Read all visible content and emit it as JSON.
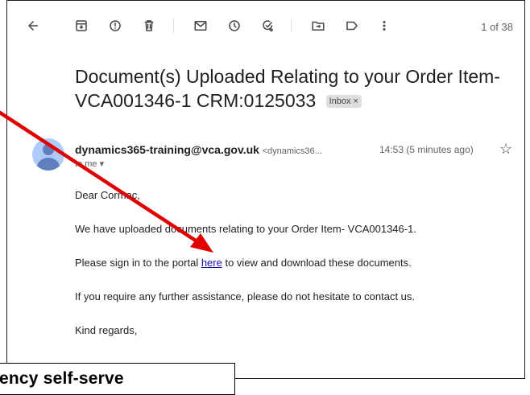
{
  "toolbar": {
    "back_icon": "arrow-left-icon",
    "counter": "1 of 38"
  },
  "message": {
    "subject": "Document(s) Uploaded Relating to your Order Item- VCA001346-1 CRM:0125033",
    "label_chip": "Inbox",
    "label_chip_close": "×",
    "sender_name": "dynamics365-training@vca.gov.uk",
    "sender_email": "<dynamics36...",
    "time": "14:53 (5 minutes ago)",
    "recipient": "to me",
    "greeting": "Dear Cormac,",
    "para1": "We have uploaded documents relating to your Order Item- VCA001346-1.",
    "para2_before": "Please sign in to the portal ",
    "para2_link": "here",
    "para2_after": " to view and download these documents.",
    "para3": "If you require any further assistance, please do not hesitate to contact us.",
    "closing": "Kind regards,"
  },
  "overlay": {
    "caption": "ency self-serve"
  },
  "colors": {
    "annotation_arrow": "#e00000",
    "link": "#1a0dab",
    "avatar": "#aecbfa"
  }
}
